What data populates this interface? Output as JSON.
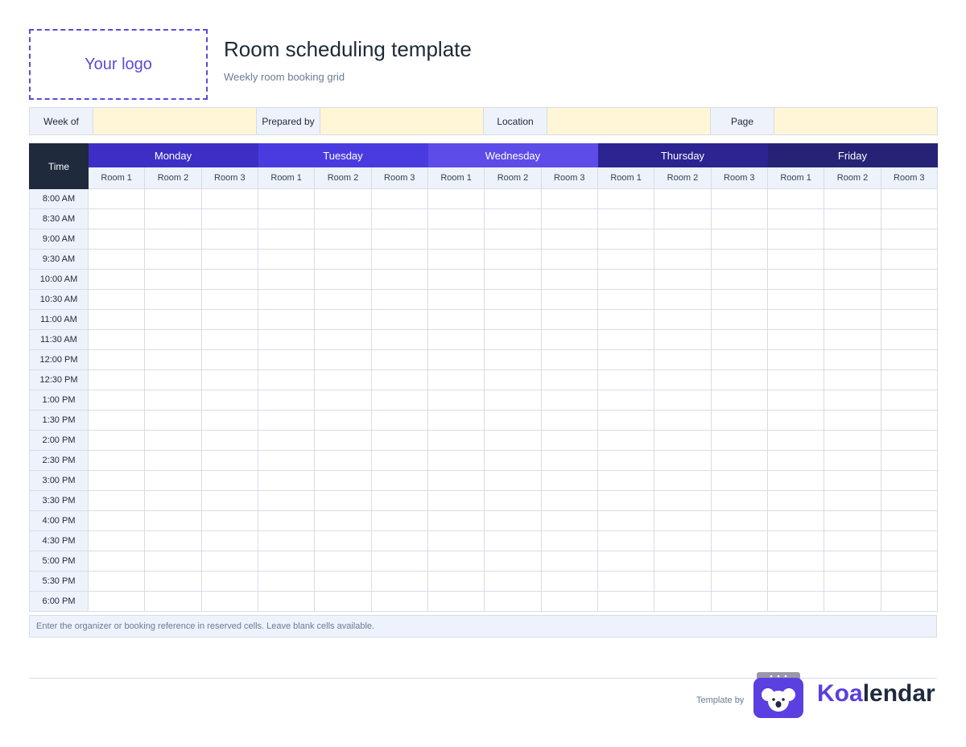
{
  "header": {
    "logo_text": "Your logo",
    "title": "Room scheduling template",
    "subtitle": "Weekly room booking grid"
  },
  "meta_fields": [
    {
      "label": "Week of",
      "value": ""
    },
    {
      "label": "Prepared by",
      "value": ""
    },
    {
      "label": "Location",
      "value": ""
    },
    {
      "label": "Page",
      "value": ""
    }
  ],
  "grid": {
    "time_header": "Time",
    "days": [
      {
        "name": "Monday",
        "color": "#3d2fc5"
      },
      {
        "name": "Tuesday",
        "color": "#4a3be0"
      },
      {
        "name": "Wednesday",
        "color": "#5d4ce8"
      },
      {
        "name": "Thursday",
        "color": "#2b2491"
      },
      {
        "name": "Friday",
        "color": "#262377"
      }
    ],
    "rooms": [
      "Room 1",
      "Room 2",
      "Room 3"
    ],
    "times": [
      "8:00 AM",
      "8:30 AM",
      "9:00 AM",
      "9:30 AM",
      "10:00 AM",
      "10:30 AM",
      "11:00 AM",
      "11:30 AM",
      "12:00 PM",
      "12:30 PM",
      "1:00 PM",
      "1:30 PM",
      "2:00 PM",
      "2:30 PM",
      "3:00 PM",
      "3:30 PM",
      "4:00 PM",
      "4:30 PM",
      "5:00 PM",
      "5:30 PM",
      "6:00 PM"
    ]
  },
  "note": "Enter the organizer or booking reference in reserved cells. Leave blank cells available.",
  "footer": {
    "template_by": "Template by",
    "brand_part1": "Koa",
    "brand_part2": "lendar",
    "brand_icon": "koala-icon",
    "brand_color": "#5b3fe0"
  }
}
